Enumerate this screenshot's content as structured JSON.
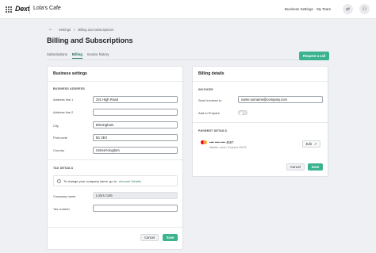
{
  "topbar": {
    "logo": "Dext",
    "company": "Lola's Cafe",
    "business_settings": "Business Settings",
    "my_team": "My Team",
    "switch_icon_glyph": "⇄",
    "user_icon_glyph": "⚇"
  },
  "breadcrumb": {
    "back_glyph": "←",
    "settings": "Settings",
    "separator": "/",
    "current": "Billing and subscriptions"
  },
  "page": {
    "title": "Billing and Subscriptions"
  },
  "tabs": [
    {
      "label": "Subscriptions",
      "active": false
    },
    {
      "label": "Billing",
      "active": true
    },
    {
      "label": "Invoice history",
      "active": false
    }
  ],
  "request_call_label": "Request a call",
  "business_settings": {
    "title": "Business settings",
    "address_section": "BUSINESS ADDRESS",
    "fields": [
      {
        "label": "Address line 1",
        "value": "321 High Road"
      },
      {
        "label": "Address line 2",
        "value": ""
      },
      {
        "label": "City",
        "value": "Birmingham"
      },
      {
        "label": "Post code",
        "value": "B1 2EX"
      },
      {
        "label": "Country",
        "value": "United Kingdom"
      }
    ],
    "tax_section": "TAX DETAILS",
    "tax_info_prefix": "To change your company name, go to",
    "tax_info_link": "Account Details",
    "company_name_label": "Company name",
    "company_name_value": "Lola's Cafe",
    "tax_number_label": "Tax number",
    "tax_number_value": "",
    "cancel_label": "Cancel",
    "save_label": "Save"
  },
  "billing_details": {
    "title": "Billing details",
    "invoices_section": "INVOICES",
    "send_invoices_label": "Send invoices to",
    "send_invoices_value": "name.surname@company.com",
    "add_to_prepare_label": "Add to Prepare",
    "add_to_prepare_on": false,
    "payment_section": "PAYMENT DETAILS",
    "card_number": "•••• •••• •••• 4567",
    "card_type": "Master card",
    "card_separator": "•",
    "card_expires": "Expires 05/22",
    "edit_label": "Edit",
    "edit_icon_glyph": "↗",
    "cancel_label": "Cancel",
    "save_label": "Save"
  },
  "colors": {
    "accent": "#3bb38f",
    "link": "#2a7e6d",
    "mastercard_red": "#eb001b",
    "mastercard_orange": "#f79e1b"
  }
}
